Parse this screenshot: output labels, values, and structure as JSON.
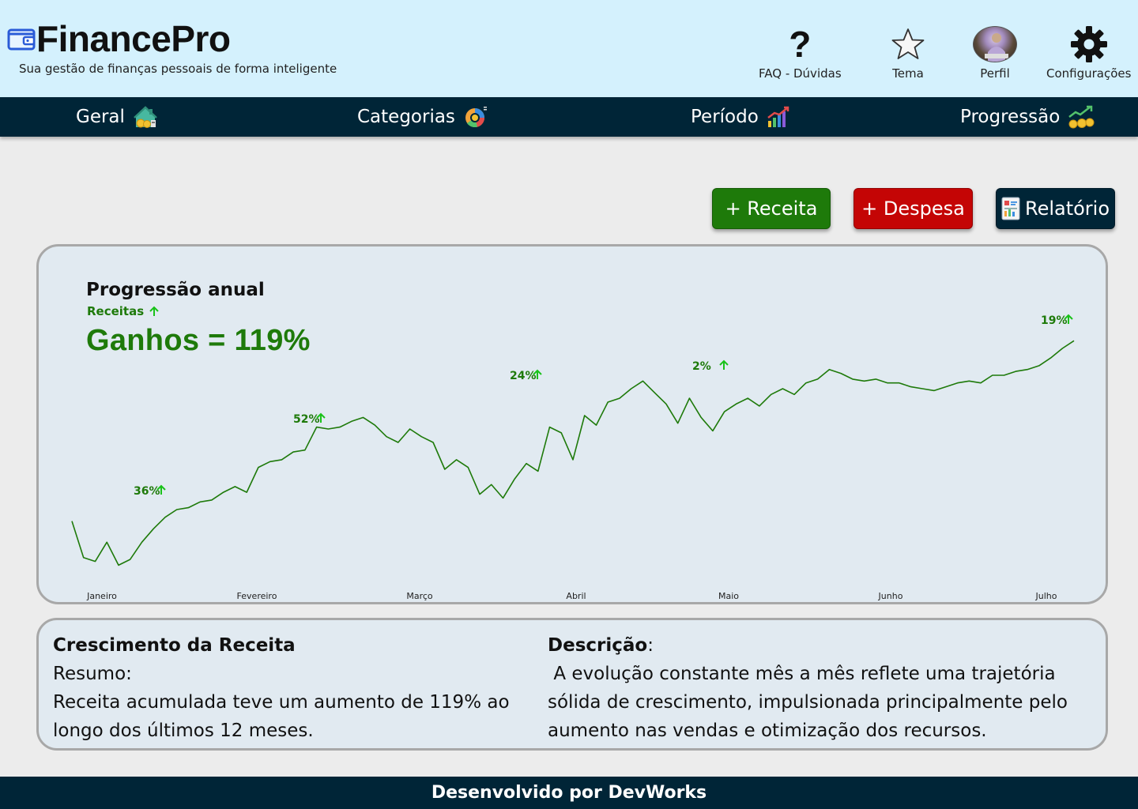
{
  "app": {
    "name": "FinancePro",
    "tagline": "Sua gestão de finanças pessoais de forma inteligente"
  },
  "header_actions": [
    {
      "label": "FAQ - Dúvidas",
      "icon": "question-icon"
    },
    {
      "label": "Tema",
      "icon": "star-icon"
    },
    {
      "label": "Perfil",
      "icon": "avatar"
    },
    {
      "label": "Configurações",
      "icon": "gear-icon"
    }
  ],
  "nav": [
    {
      "label": "Geral",
      "icon": "house-money-icon"
    },
    {
      "label": "Categorias",
      "icon": "pie-chart-icon"
    },
    {
      "label": "Período",
      "icon": "bar-chart-icon"
    },
    {
      "label": "Progressão",
      "icon": "growth-coins-icon"
    }
  ],
  "actions": {
    "receita": "+ Receita",
    "despesa": "+ Despesa",
    "relatorio": "Relatório"
  },
  "colors": {
    "header_bg": "#d4f1fd",
    "nav_bg": "#002537",
    "green": "#1e7a0a",
    "red": "#c40505",
    "card_bg": "#e1eaf1",
    "arrow_green": "#19c219"
  },
  "chart_card": {
    "title": "Progressão anual",
    "subtitle": "Receitas",
    "headline": "Ganhos = 119%"
  },
  "chart_data": {
    "type": "line",
    "x_labels": [
      "Janeiro",
      "Fevereiro",
      "Março",
      "Abril",
      "Maio",
      "Junho",
      "Julho"
    ],
    "annotations": [
      {
        "label": "36%",
        "month": "Janeiro"
      },
      {
        "label": "52%",
        "month": "Fevereiro"
      },
      {
        "label": "24%",
        "month": "Março"
      },
      {
        "label": "2%",
        "month": "Abril"
      },
      {
        "label": "19%",
        "month": "Julho"
      }
    ],
    "values": [
      36,
      17,
      15,
      25,
      13,
      16,
      25,
      32,
      38,
      42,
      43,
      46,
      47,
      51,
      54,
      51,
      64,
      67,
      68,
      72,
      73,
      85,
      84,
      85,
      88,
      90,
      86,
      80,
      77,
      84,
      80,
      77,
      63,
      68,
      64,
      50,
      55,
      48,
      58,
      66,
      62,
      85,
      82,
      68,
      91,
      86,
      98,
      100,
      105,
      109,
      103,
      97,
      87,
      100,
      90,
      83,
      93,
      97,
      100,
      96,
      102,
      105,
      102,
      108,
      110,
      115,
      113,
      110,
      109,
      110,
      108,
      108,
      106,
      105,
      104,
      106,
      108,
      109,
      108,
      112,
      112,
      114,
      115,
      117,
      121,
      126,
      130
    ]
  },
  "summary": {
    "left_title": "Crescimento da Receita",
    "left_label": "Resumo:",
    "left_text": "Receita acumulada teve um aumento de 119% ao longo dos últimos 12 meses.",
    "right_title": "Descrição",
    "right_colon": ":",
    "right_text": " A evolução constante mês a mês reflete uma trajetória sólida de crescimento, impulsionada principalmente pelo aumento nas vendas e otimização dos recursos."
  },
  "footer": {
    "text": "Desenvolvido por DevWorks"
  }
}
